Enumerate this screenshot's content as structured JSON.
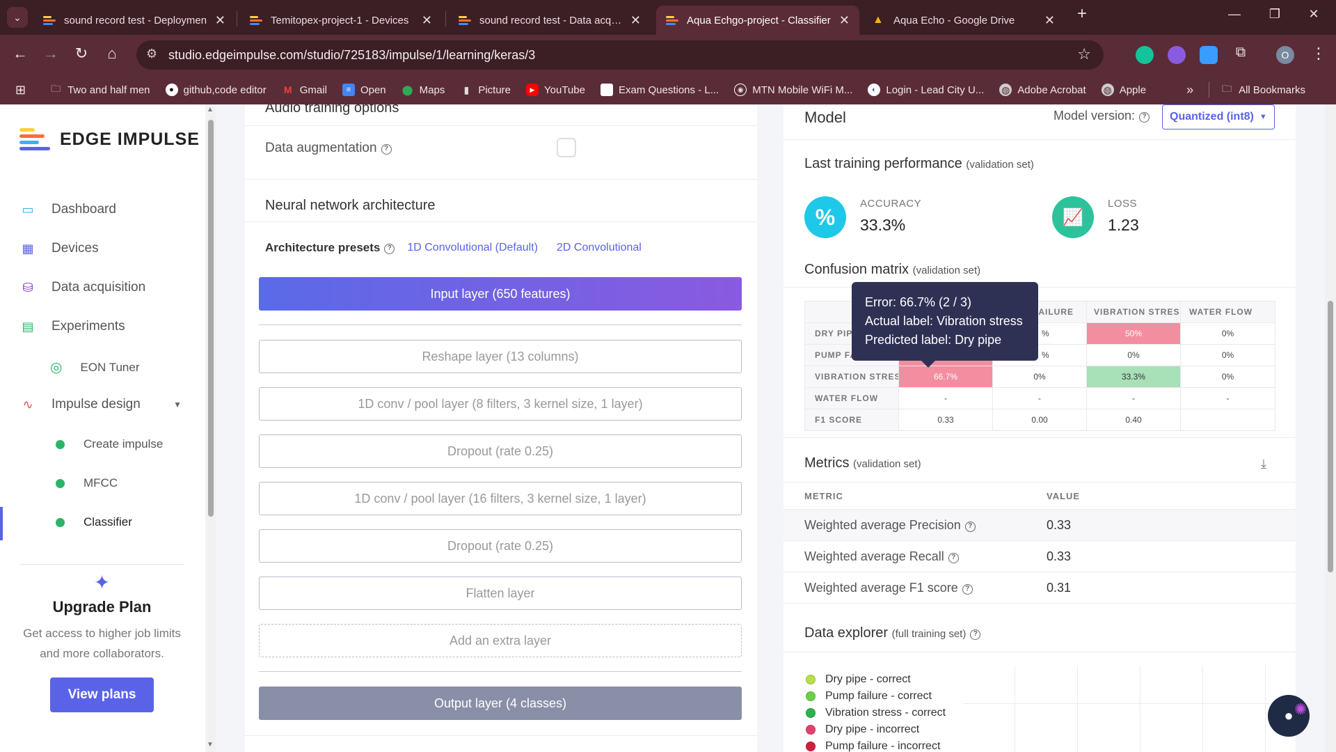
{
  "browser": {
    "tabs": [
      {
        "title": "sound record test - Deploymen",
        "active": false
      },
      {
        "title": "Temitopex-project-1 - Devices",
        "active": false
      },
      {
        "title": "sound record test - Data acquis",
        "active": false
      },
      {
        "title": "Aqua Echgo-project - Classifier",
        "active": true
      },
      {
        "title": "Aqua Echo - Google Drive",
        "active": false
      }
    ],
    "url": "studio.edgeimpulse.com/studio/725183/impulse/1/learning/keras/3",
    "profile_initial": "O",
    "bookmarks": [
      "Two and half men",
      "github,code editor",
      "Gmail",
      "Open",
      "Maps",
      "Picture",
      "YouTube",
      "Exam Questions - L...",
      "MTN Mobile WiFi M...",
      "Login - Lead City U...",
      "Adobe Acrobat",
      "Apple"
    ],
    "all_bookmarks": "All Bookmarks"
  },
  "sidebar": {
    "brand": "EDGE IMPULSE",
    "items": [
      {
        "label": "Dashboard",
        "icon": "monitor-icon"
      },
      {
        "label": "Devices",
        "icon": "chip-icon"
      },
      {
        "label": "Data acquisition",
        "icon": "database-icon"
      },
      {
        "label": "Experiments",
        "icon": "table-icon"
      },
      {
        "label": "EON Tuner",
        "icon": "compass-icon"
      },
      {
        "label": "Impulse design",
        "icon": "pulse-icon"
      }
    ],
    "subitems": [
      "Create impulse",
      "MFCC",
      "Classifier"
    ],
    "upgrade": {
      "title": "Upgrade Plan",
      "text": "Get access to higher job limits and more collaborators.",
      "button": "View plans"
    }
  },
  "architecture": {
    "audio_options_title": "Audio training options",
    "data_augmentation": "Data augmentation",
    "nn_title": "Neural network architecture",
    "presets_label": "Architecture presets",
    "preset_1d": "1D Convolutional (Default)",
    "preset_2d": "2D Convolutional",
    "input_layer": "Input layer (650 features)",
    "layers": [
      "Reshape layer (13 columns)",
      "1D conv / pool layer (8 filters, 3 kernel size, 1 layer)",
      "Dropout (rate 0.25)",
      "1D conv / pool layer (16 filters, 3 kernel size, 1 layer)",
      "Dropout (rate 0.25)",
      "Flatten layer"
    ],
    "add_layer": "Add an extra layer",
    "output_layer": "Output layer (4 classes)"
  },
  "model": {
    "title": "Model",
    "version_label": "Model version:",
    "version_value": "Quantized (int8)",
    "last_training_title": "Last training performance",
    "last_training_sub": "(validation set)",
    "accuracy_label": "ACCURACY",
    "accuracy_value": "33.3%",
    "loss_label": "LOSS",
    "loss_value": "1.23",
    "confusion_title": "Confusion matrix",
    "confusion_sub": "(validation set)",
    "confusion": {
      "columns": [
        "",
        "AILURE",
        "VIBRATION STRESS",
        "WATER FLOW"
      ],
      "rows": [
        {
          "label": "DRY PIPE",
          "cells": [
            "",
            "%",
            "50%",
            "0%"
          ]
        },
        {
          "label": "PUMP FAILURE",
          "cells": [
            "",
            "%",
            "0%",
            "0%"
          ]
        },
        {
          "label": "VIBRATION STRESS",
          "cells": [
            "66.7%",
            "0%",
            "33.3%",
            "0%"
          ]
        },
        {
          "label": "WATER FLOW",
          "cells": [
            "-",
            "-",
            "-",
            "-"
          ]
        },
        {
          "label": "F1 SCORE",
          "cells": [
            "0.33",
            "0.00",
            "0.40",
            ""
          ]
        }
      ]
    },
    "tooltip": {
      "error": "Error: 66.7% (2 / 3)",
      "actual": "Actual label: Vibration stress",
      "predicted": "Predicted label: Dry pipe"
    },
    "metrics_title": "Metrics",
    "metrics_sub": "(validation set)",
    "metrics_col_metric": "METRIC",
    "metrics_col_value": "VALUE",
    "metrics": [
      {
        "name": "Weighted average Precision",
        "value": "0.33"
      },
      {
        "name": "Weighted average Recall",
        "value": "0.33"
      },
      {
        "name": "Weighted average F1 score",
        "value": "0.31"
      }
    ],
    "explorer_title": "Data explorer",
    "explorer_sub": "(full training set)",
    "legend": [
      {
        "label": "Dry pipe - correct",
        "color": "#b8e04a"
      },
      {
        "label": "Pump failure - correct",
        "color": "#6cd04a"
      },
      {
        "label": "Vibration stress - correct",
        "color": "#2cb34a"
      },
      {
        "label": "Dry pipe - incorrect",
        "color": "#e0406a"
      },
      {
        "label": "Pump failure - incorrect",
        "color": "#d02040"
      }
    ]
  },
  "colors": {
    "accent": "#5a63e8",
    "accuracy": "#1ec8e8",
    "loss": "#2cc39a"
  }
}
